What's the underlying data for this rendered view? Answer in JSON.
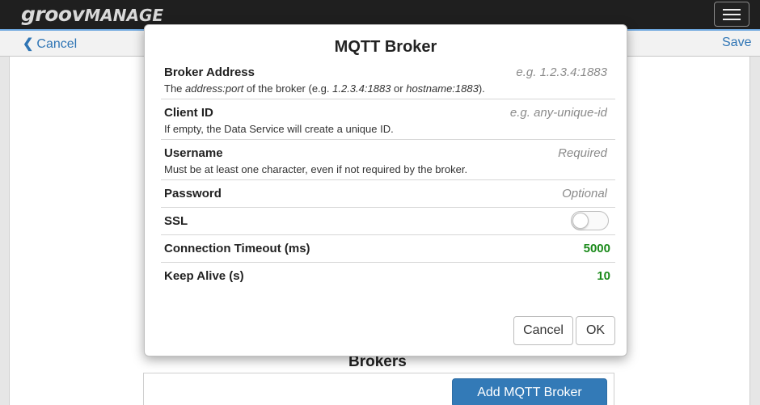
{
  "app": {
    "logo_main": "groov",
    "logo_sub": "MANAGE"
  },
  "nav": {
    "cancel_label": "Cancel",
    "save_label": "Save"
  },
  "background": {
    "brokers_title": "Brokers",
    "add_broker_label": "Add MQTT Broker"
  },
  "modal": {
    "title": "MQTT Broker",
    "fields": {
      "broker_address": {
        "label": "Broker Address",
        "placeholder": "e.g. 1.2.3.4:1883",
        "help_pre": "The ",
        "help_em1": "address:port",
        "help_mid": " of the broker (e.g. ",
        "help_em2": "1.2.3.4:1883",
        "help_or": " or ",
        "help_em3": "hostname:1883",
        "help_post": ")."
      },
      "client_id": {
        "label": "Client ID",
        "placeholder": "e.g. any-unique-id",
        "help": "If empty, the Data Service will create a unique ID."
      },
      "username": {
        "label": "Username",
        "placeholder": "Required",
        "help": "Must be at least one character, even if not required by the broker."
      },
      "password": {
        "label": "Password",
        "placeholder": "Optional"
      },
      "ssl": {
        "label": "SSL",
        "enabled": false
      },
      "connection_timeout": {
        "label": "Connection Timeout (ms)",
        "value": "5000"
      },
      "keep_alive": {
        "label": "Keep Alive (s)",
        "value": "10"
      }
    },
    "cancel_label": "Cancel",
    "ok_label": "OK"
  },
  "colors": {
    "topbar": "#1f1f1f",
    "link_blue": "#2f75b5",
    "primary_button": "#337ab7",
    "numeric_value": "#1a8a1a"
  }
}
